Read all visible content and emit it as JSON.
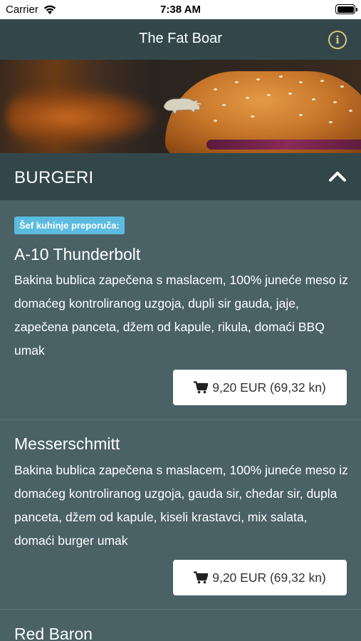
{
  "status_bar": {
    "carrier": "Carrier",
    "time": "7:38 AM"
  },
  "nav": {
    "title": "The Fat Boar",
    "info_icon": "info-circle-icon",
    "accent": "#d9c27a"
  },
  "category": {
    "label": "BURGERI",
    "expanded": true
  },
  "items": [
    {
      "badge": "Šef kuhinje preporuča:",
      "name": "A-10 Thunderbolt",
      "description": "Bakina bublica zapečena s maslacem, 100% juneće meso iz domaćeg kontroliranog uzgoja, dupli sir gauda, jaje, zapečena panceta, džem od kapule, rikula, domaći BBQ umak",
      "price": "9,20 EUR (69,32 kn)"
    },
    {
      "name": "Messerschmitt",
      "description": "Bakina bublica zapečena s maslacem, 100% juneće meso iz domaćeg kontroliranog uzgoja, gauda sir, chedar sir, dupla panceta, džem od kapule, kiseli krastavci, mix salata, domaći burger umak",
      "price": "9,20 EUR (69,32 kn)"
    },
    {
      "name": "Red Baron"
    }
  ]
}
